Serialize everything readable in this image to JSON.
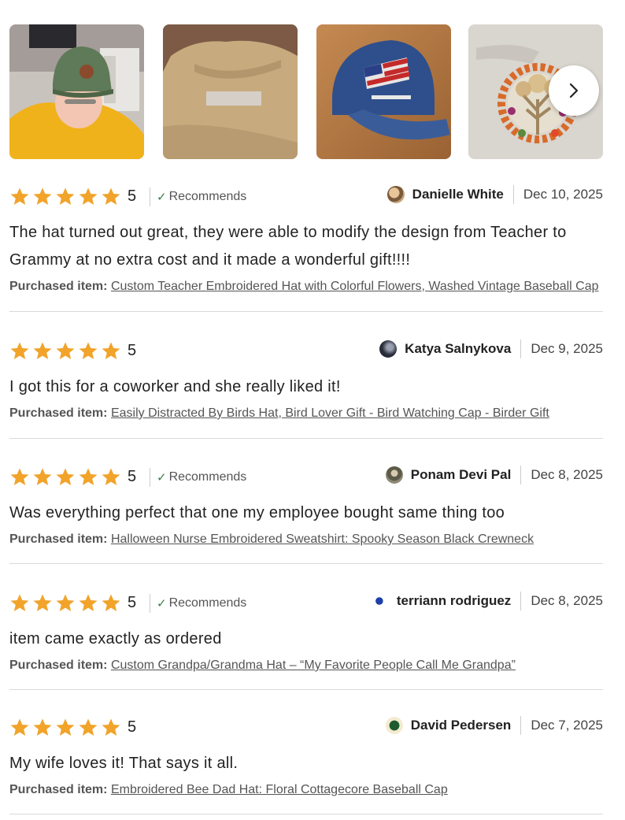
{
  "gallery": {
    "photos": [
      {
        "icon": "photo-person-green-hat"
      },
      {
        "icon": "photo-tan-sweatshirt"
      },
      {
        "icon": "photo-blue-usa-cap"
      },
      {
        "icon": "photo-floral-tree-shirt"
      }
    ],
    "next_icon": "chevron-right-icon"
  },
  "colors": {
    "star": "#f1a32a",
    "check": "#3a7d44",
    "divider": "#d9d9d9"
  },
  "reviews": [
    {
      "rating": "5",
      "stars": 5,
      "recommends": "Recommends",
      "author": "Danielle White",
      "date": "Dec 10, 2025",
      "text": "The hat turned out great, they were able to modify the design from Teacher to Grammy at no extra cost and it made a wonderful gift!!!!",
      "purchased_label": "Purchased item:",
      "purchased_item": "Custom Teacher Embroidered Hat with Colorful Flowers, Washed Vintage Baseball Cap"
    },
    {
      "rating": "5",
      "stars": 5,
      "author": "Katya Salnykova",
      "date": "Dec 9, 2025",
      "text": "I got this for a coworker and she really liked it!",
      "purchased_label": "Purchased item:",
      "purchased_item": "Easily Distracted By Birds Hat, Bird Lover Gift - Bird Watching Cap - Birder Gift"
    },
    {
      "rating": "5",
      "stars": 5,
      "recommends": "Recommends",
      "author": "Ponam Devi Pal",
      "date": "Dec 8, 2025",
      "text": "Was everything perfect that one my employee bought same thing too",
      "purchased_label": "Purchased item:",
      "purchased_item": "Halloween Nurse Embroidered Sweatshirt: Spooky Season Black Crewneck"
    },
    {
      "rating": "5",
      "stars": 5,
      "recommends": "Recommends",
      "author": "terriann rodriguez",
      "date": "Dec 8, 2025",
      "text": "item came exactly as ordered",
      "purchased_label": "Purchased item:",
      "purchased_item": "Custom Grandpa/Grandma Hat – “My Favorite People Call Me Grandpa”"
    },
    {
      "rating": "5",
      "stars": 5,
      "author": "David Pedersen",
      "date": "Dec 7, 2025",
      "text": "My wife loves it! That says it all.",
      "purchased_label": "Purchased item:",
      "purchased_item": "Embroidered Bee Dad Hat: Floral Cottagecore Baseball Cap"
    }
  ]
}
